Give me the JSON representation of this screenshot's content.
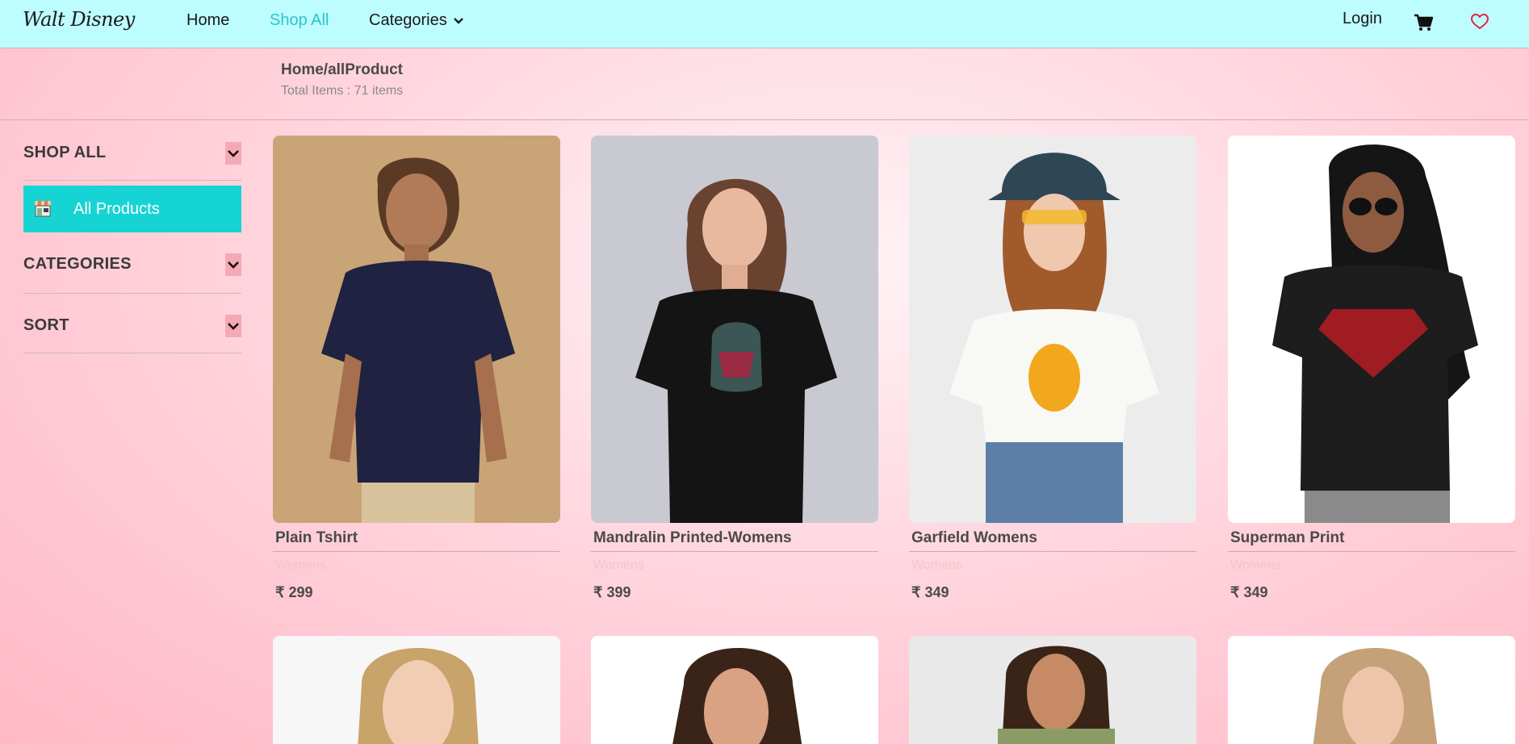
{
  "nav": {
    "logo": "Walt Disney",
    "home": "Home",
    "shop_all": "Shop All",
    "categories": "Categories",
    "login": "Login"
  },
  "breadcrumb": {
    "path": "Home/allProduct",
    "total": "Total Items : 71 items"
  },
  "sidebar": {
    "shop_all": "SHOP ALL",
    "all_products": "All Products",
    "categories": "CATEGORIES",
    "sort": "SORT"
  },
  "products": [
    {
      "name": "Plain Tshirt",
      "category": "Womens",
      "price": "₹ 299"
    },
    {
      "name": "Mandralin Printed-Womens",
      "category": "Womens",
      "price": "₹ 399"
    },
    {
      "name": "Garfield Womens",
      "category": "Womens",
      "price": "₹ 349"
    },
    {
      "name": "Superman Print",
      "category": "Womens",
      "price": "₹ 349"
    }
  ],
  "colors": {
    "navbar": "#bdfcff",
    "accent": "#2ec4cf",
    "all_products_bg": "#17d4d4",
    "toggle_bg": "#f4a9b7",
    "heart": "#e0293b"
  }
}
